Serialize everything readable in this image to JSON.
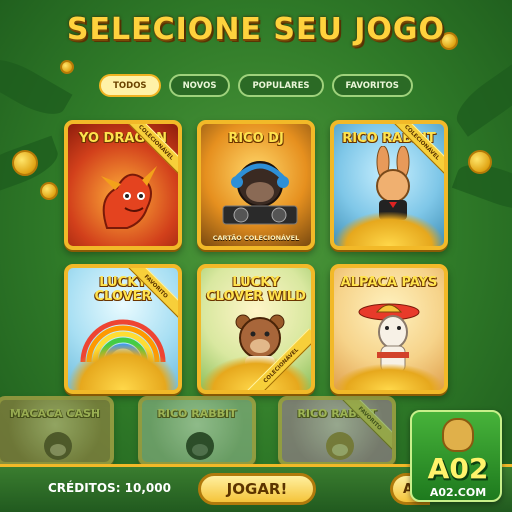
{
  "title": "SELECIONE SEU JOGO",
  "filters": [
    {
      "label": "TODOS",
      "active": true
    },
    {
      "label": "NOVOS",
      "active": false
    },
    {
      "label": "POPULARES",
      "active": false
    },
    {
      "label": "FAVORITOS",
      "active": false
    }
  ],
  "games": [
    {
      "title": "YO DRAGON",
      "ribbon": "COLECIONÁVEL"
    },
    {
      "title": "RICO DJ",
      "caption": "CARTÃO COLECIONÁVEL"
    },
    {
      "title": "RICO RABBIT",
      "ribbon": "COLECIONÁVEL"
    },
    {
      "title": "LUCKY CLOVER",
      "ribbon": "FAVORITO"
    },
    {
      "title": "LUCKY CLOVER WILD",
      "ribbon": "COLECIONÁVEL"
    },
    {
      "title": "ALPACA PAYS"
    }
  ],
  "more_games": [
    {
      "title": "MACACA CASH"
    },
    {
      "title": "RICO RABBIT"
    },
    {
      "title": "RICO RABBIT",
      "ribbon": "FAVORITO"
    }
  ],
  "bottom_bar": {
    "credits": "CRÉDITOS: 10,000",
    "play_label": "JOGAR!",
    "side_label": "A"
  },
  "logo": {
    "mark": "A02",
    "sub": "A02.COM"
  },
  "colors": {
    "accent": "#f2b928",
    "background": "#2f7a28",
    "title": "#ffd23d"
  }
}
